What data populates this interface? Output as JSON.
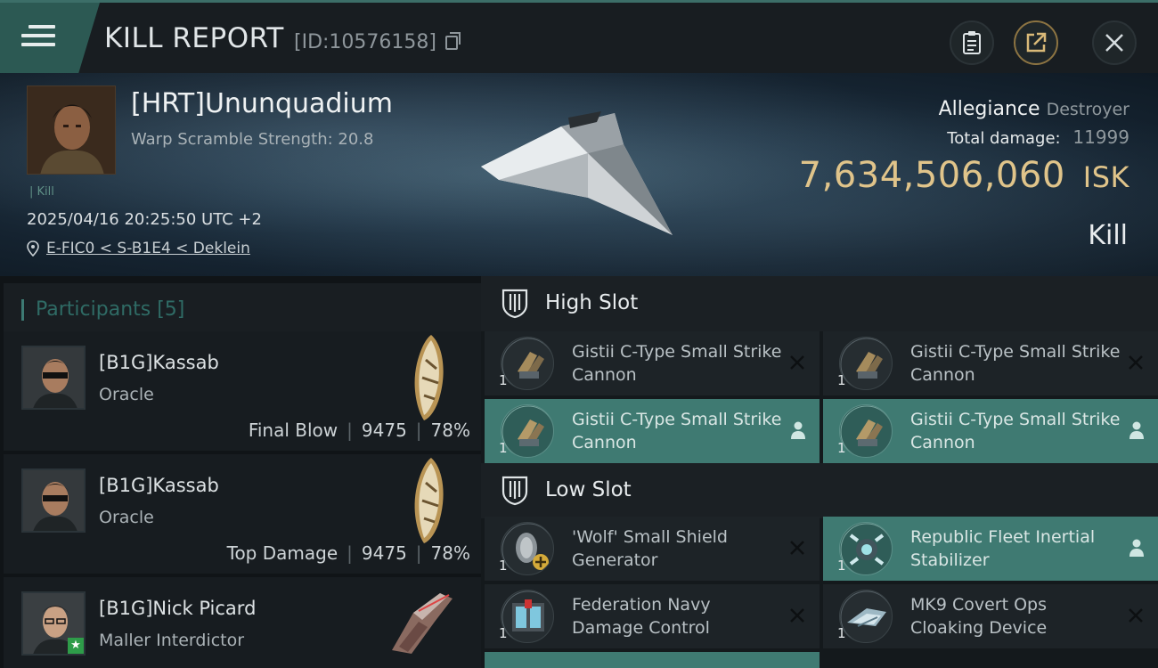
{
  "header": {
    "title": "KILL REPORT",
    "report_id": "[ID:10576158]",
    "icons": [
      "menu-icon",
      "copy-icon",
      "clipboard-icon",
      "share-icon",
      "close-icon"
    ]
  },
  "victim": {
    "name": "[HRT]Ununquadium",
    "warp_scramble": "Warp Scramble Strength: 20.8",
    "kill_tag": "| Kill",
    "datetime": "2025/04/16 20:25:50 UTC +2",
    "location": "E-FIC0 < S-B1E4 < Deklein",
    "allegiance": "Allegiance",
    "ship_class": "Destroyer",
    "total_damage_label": "Total damage:",
    "total_damage": "11999",
    "isk_value": "7,634,506,060",
    "isk_unit": "ISK",
    "result": "Kill"
  },
  "participants": {
    "label": "Participants [5]",
    "rows": [
      {
        "name": "[B1G]Kassab",
        "ship": "Oracle",
        "role": "Final Blow",
        "damage": "9475",
        "pct": "78%"
      },
      {
        "name": "[B1G]Kassab",
        "ship": "Oracle",
        "role": "Top Damage",
        "damage": "9475",
        "pct": "78%"
      },
      {
        "name": "[B1G]Nick Picard",
        "ship": "Maller Interdictor",
        "role": "",
        "damage": "",
        "pct": ""
      }
    ]
  },
  "slots": {
    "high": {
      "label": "High Slot",
      "items": [
        {
          "name": "Gistii C-Type Small Strike Cannon",
          "qty": "1",
          "state": "destroyed"
        },
        {
          "name": "Gistii C-Type Small Strike Cannon",
          "qty": "1",
          "state": "destroyed"
        },
        {
          "name": "Gistii C-Type Small Strike Cannon",
          "qty": "1",
          "state": "dropped"
        },
        {
          "name": "Gistii C-Type Small Strike Cannon",
          "qty": "1",
          "state": "dropped"
        }
      ]
    },
    "low": {
      "label": "Low Slot",
      "items": [
        {
          "name": "'Wolf' Small Shield Generator",
          "qty": "1",
          "state": "destroyed"
        },
        {
          "name": "Republic Fleet Inertial Stabilizer",
          "qty": "1",
          "state": "dropped"
        },
        {
          "name": "Federation Navy Damage Control",
          "qty": "1",
          "state": "destroyed"
        },
        {
          "name": "MK9 Covert Ops Cloaking Device",
          "qty": "1",
          "state": "destroyed"
        }
      ]
    }
  },
  "colors": {
    "accent": "#3f7a72",
    "isk": "#e0c48a",
    "topbar_wedge": "#2c5953"
  }
}
